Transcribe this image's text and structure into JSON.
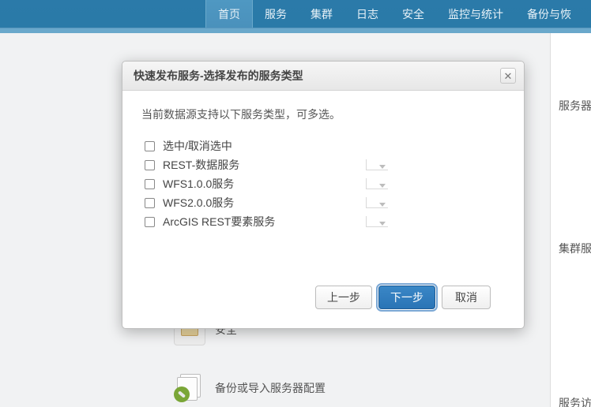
{
  "nav": {
    "items": [
      {
        "label": "首页",
        "active": true
      },
      {
        "label": "服务",
        "active": false
      },
      {
        "label": "集群",
        "active": false
      },
      {
        "label": "日志",
        "active": false
      },
      {
        "label": "安全",
        "active": false
      },
      {
        "label": "监控与统计",
        "active": false
      },
      {
        "label": "备份与恢",
        "active": false
      }
    ]
  },
  "rightPanel": {
    "label1": "服务器基",
    "label2": "集群服务",
    "label3": "服务访问"
  },
  "bgRows": {
    "security": "安全",
    "backup": "备份或导入服务器配置"
  },
  "dialog": {
    "title": "快速发布服务-选择发布的服务类型",
    "closeGlyph": "✕",
    "description": "当前数据源支持以下服务类型，可多选。",
    "options": [
      {
        "label": "选中/取消选中",
        "hasTray": false
      },
      {
        "label": "REST-数据服务",
        "hasTray": true
      },
      {
        "label": "WFS1.0.0服务",
        "hasTray": true
      },
      {
        "label": "WFS2.0.0服务",
        "hasTray": true
      },
      {
        "label": "ArcGIS REST要素服务",
        "hasTray": true
      }
    ],
    "buttons": {
      "prev": "上一步",
      "next": "下一步",
      "cancel": "取消"
    }
  }
}
